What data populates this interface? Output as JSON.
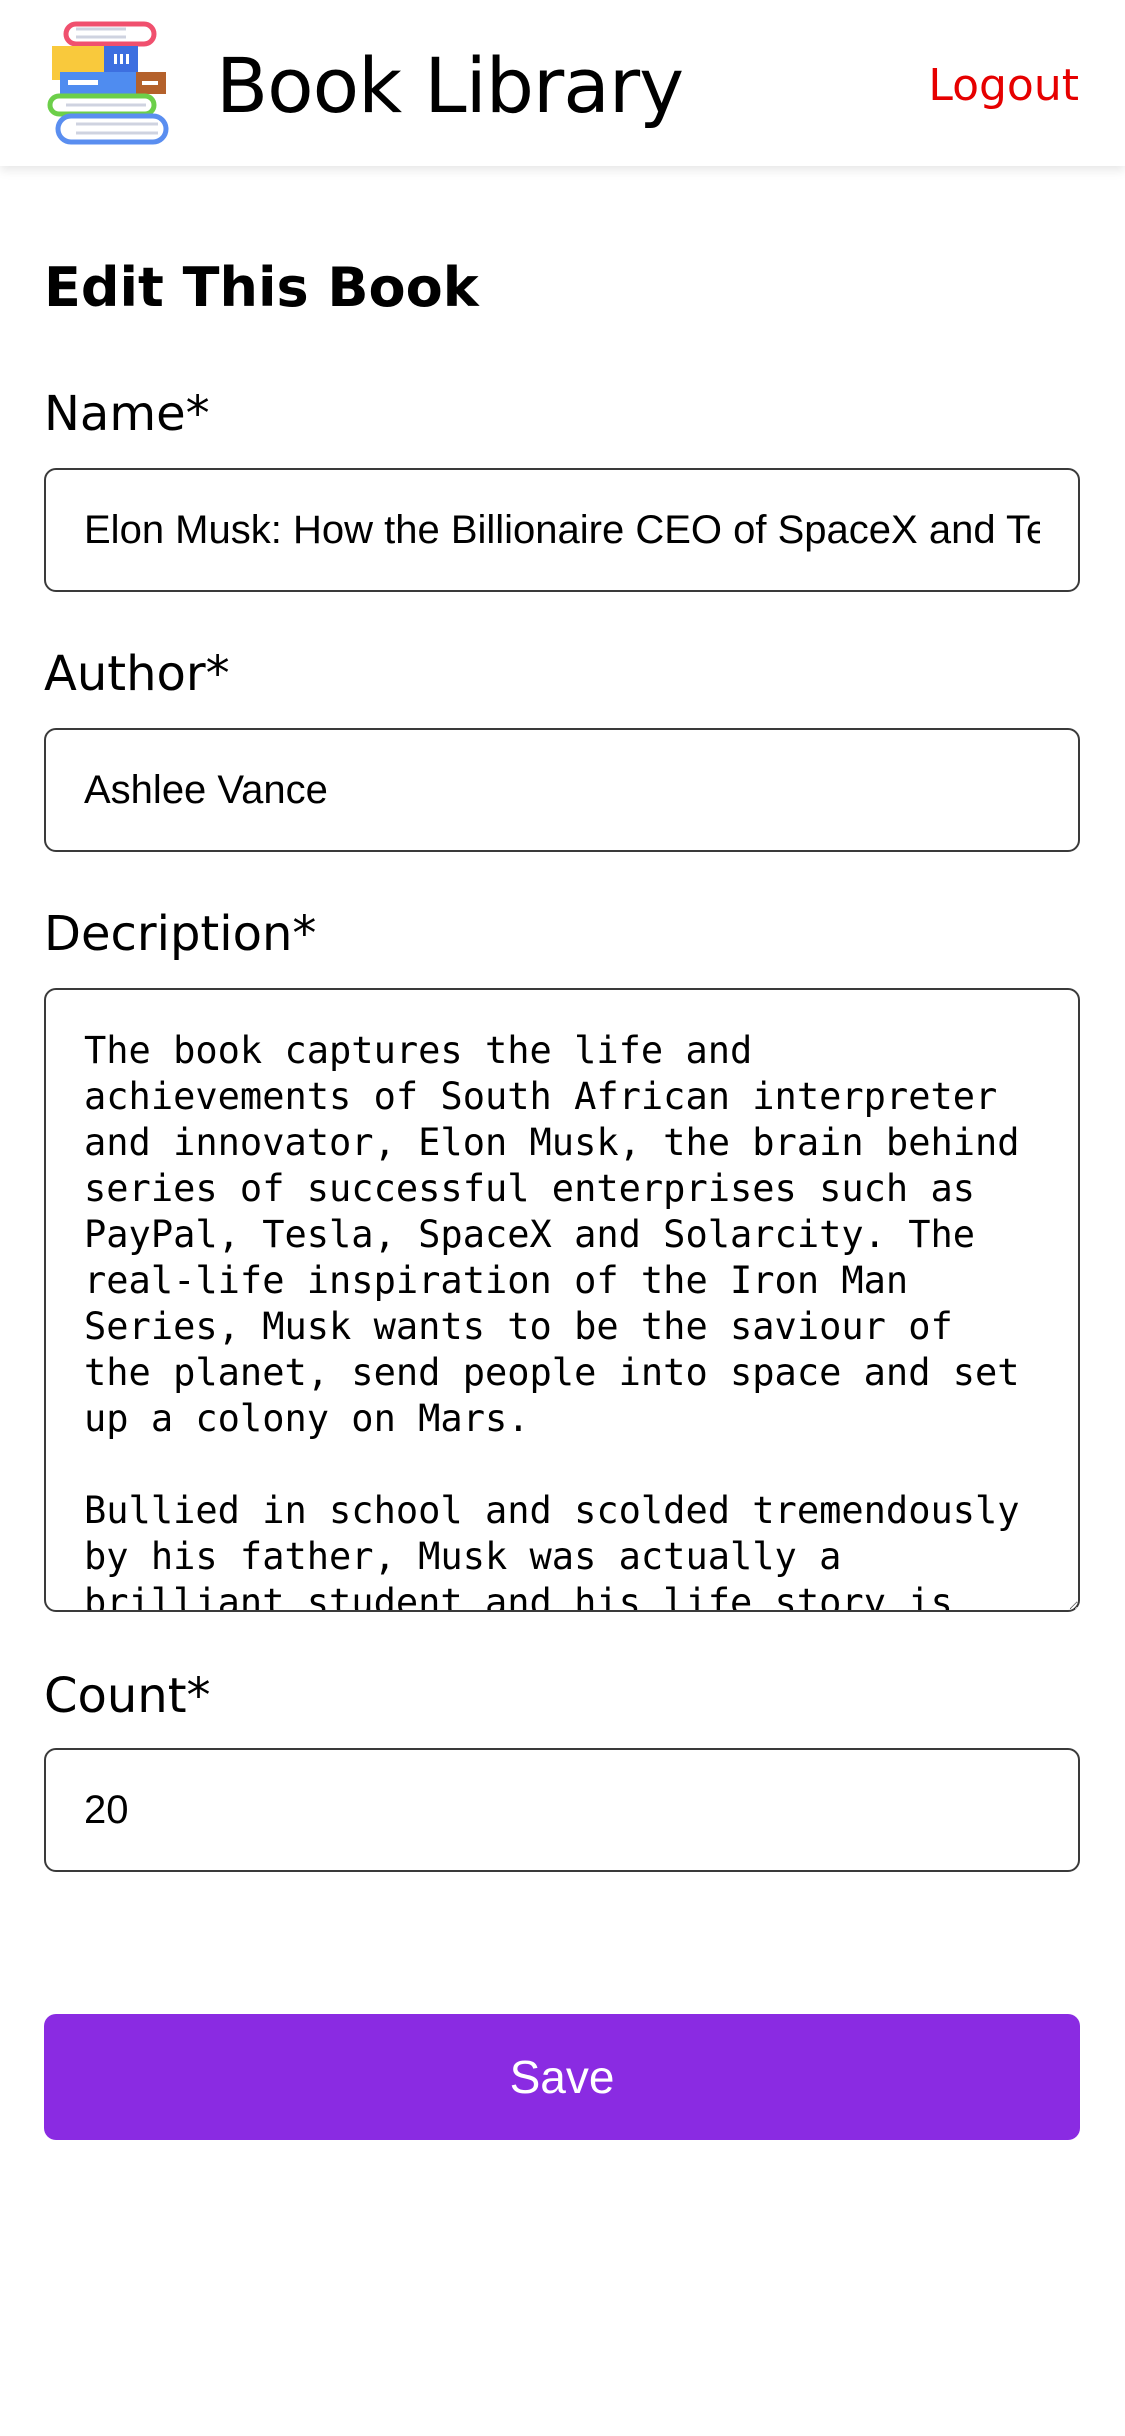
{
  "header": {
    "app_title": "Book Library",
    "logout_label": "Logout",
    "logo_icon": "books-stack-icon"
  },
  "form": {
    "title": "Edit This Book",
    "name": {
      "label": "Name*",
      "value": "Elon Musk: How the Billionaire CEO of SpaceX and Tesla is Shaping our Future"
    },
    "author": {
      "label": "Author*",
      "value": "Ashlee Vance"
    },
    "description": {
      "label": "Decription*",
      "value": "The book captures the life and achievements of South African interpreter and innovator, Elon Musk, the brain behind series of successful enterprises such as PayPal, Tesla, SpaceX and Solarcity. The real-life inspiration of the Iron Man Series, Musk wants to be the saviour of the planet, send people into space and set up a colony on Mars.\n\nBullied in school and scolded tremendously by his father, Musk was actually a brilliant student and his life story is"
    },
    "count": {
      "label": "Count*",
      "value": "20"
    },
    "save_label": "Save"
  },
  "colors": {
    "accent": "#8a2be2",
    "logout": "#e60000"
  }
}
